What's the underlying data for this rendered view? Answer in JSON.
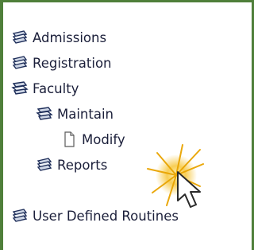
{
  "tree": {
    "items": [
      {
        "label": "Admissions",
        "icon": "books-icon",
        "level": 0
      },
      {
        "label": "Registration",
        "icon": "books-icon",
        "level": 0
      },
      {
        "label": "Faculty",
        "icon": "books-open-icon",
        "level": 0
      },
      {
        "label": "Maintain",
        "icon": "books-open-icon",
        "level": 1
      },
      {
        "label": "Modify",
        "icon": "page-icon",
        "level": 2
      },
      {
        "label": "Reports",
        "icon": "books-icon",
        "level": 1
      },
      {
        "label": "User Defined Routines",
        "icon": "books-icon",
        "level": 0
      }
    ]
  },
  "colors": {
    "frame": "#4f7f3a",
    "text": "#1b1f3a",
    "highlight": "#f6c22b"
  }
}
